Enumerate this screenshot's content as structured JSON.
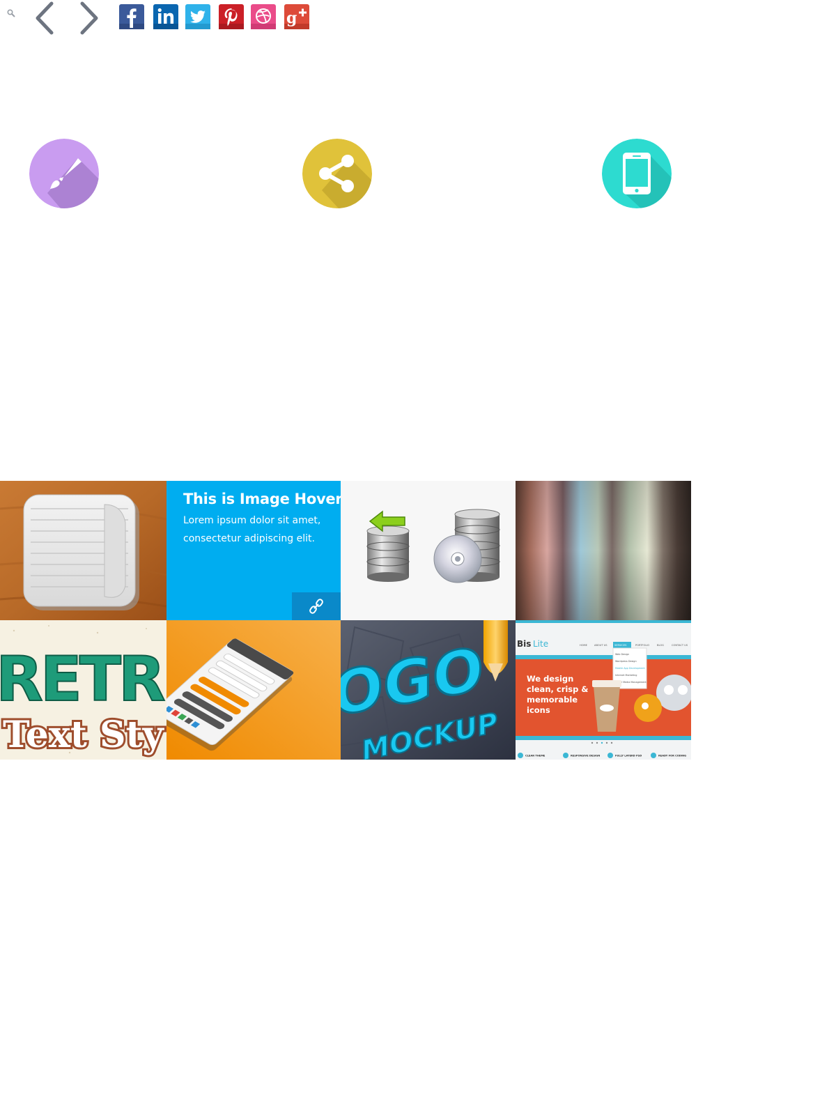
{
  "toolbar": {
    "search_icon": "search-icon",
    "prev_icon": "chevron-left-icon",
    "next_icon": "chevron-right-icon"
  },
  "social": [
    {
      "name": "facebook",
      "glyph": "f",
      "color": "#3b5a9a"
    },
    {
      "name": "linkedin",
      "glyph": "in",
      "color": "#0a66b0"
    },
    {
      "name": "twitter",
      "glyph": "twitter-bird",
      "color": "#2fb2ea"
    },
    {
      "name": "pinterest",
      "glyph": "P",
      "color": "#cb2027"
    },
    {
      "name": "dribbble",
      "glyph": "dribbble-ball",
      "color": "#ea4c89"
    },
    {
      "name": "google-plus",
      "glyph": "g+",
      "color": "#dd4b39"
    }
  ],
  "features": [
    {
      "icon": "paintbrush-icon",
      "color": "#c99cf0"
    },
    {
      "icon": "share-icon",
      "color": "#e0c23a"
    },
    {
      "icon": "smartphone-icon",
      "color": "#2ddbd0"
    }
  ],
  "portfolio": {
    "hover_title": "This is Image Hover",
    "hover_text": "Lorem ipsum dolor sit amet, consectetur adipiscing elit.",
    "link_icon": "link-icon",
    "items": [
      {
        "name": "notes-app-icon"
      },
      {
        "name": "image-hover-card"
      },
      {
        "name": "database-backup-icon"
      },
      {
        "name": "blurred-stripes"
      },
      {
        "name": "retro-text-style",
        "text_1": "RETR",
        "text_2": "Text Sty"
      },
      {
        "name": "mobile-ui-kit"
      },
      {
        "name": "logo-mockup",
        "text_1": "OGO",
        "text_2": "MOCKUP"
      },
      {
        "name": "bislite-template",
        "brand": "Bis",
        "brand_suffix": "Lite",
        "nav": [
          "HOME",
          "ABOUT US",
          "SERVICES",
          "PORTFOLIO",
          "BLOG",
          "CONTACT US"
        ],
        "menu": [
          "Web Design",
          "Wordpress Design",
          "Mobile App Development",
          "Internet Marketing",
          "Social Media Management"
        ],
        "headline": [
          "We design",
          "clean, crisp &",
          "memorable",
          "icons"
        ],
        "features": [
          "CLEAN THEME",
          "RESPONSIVE DESIGN",
          "FULLY LAYERD PSD",
          "READY FOR CODING"
        ]
      }
    ]
  }
}
